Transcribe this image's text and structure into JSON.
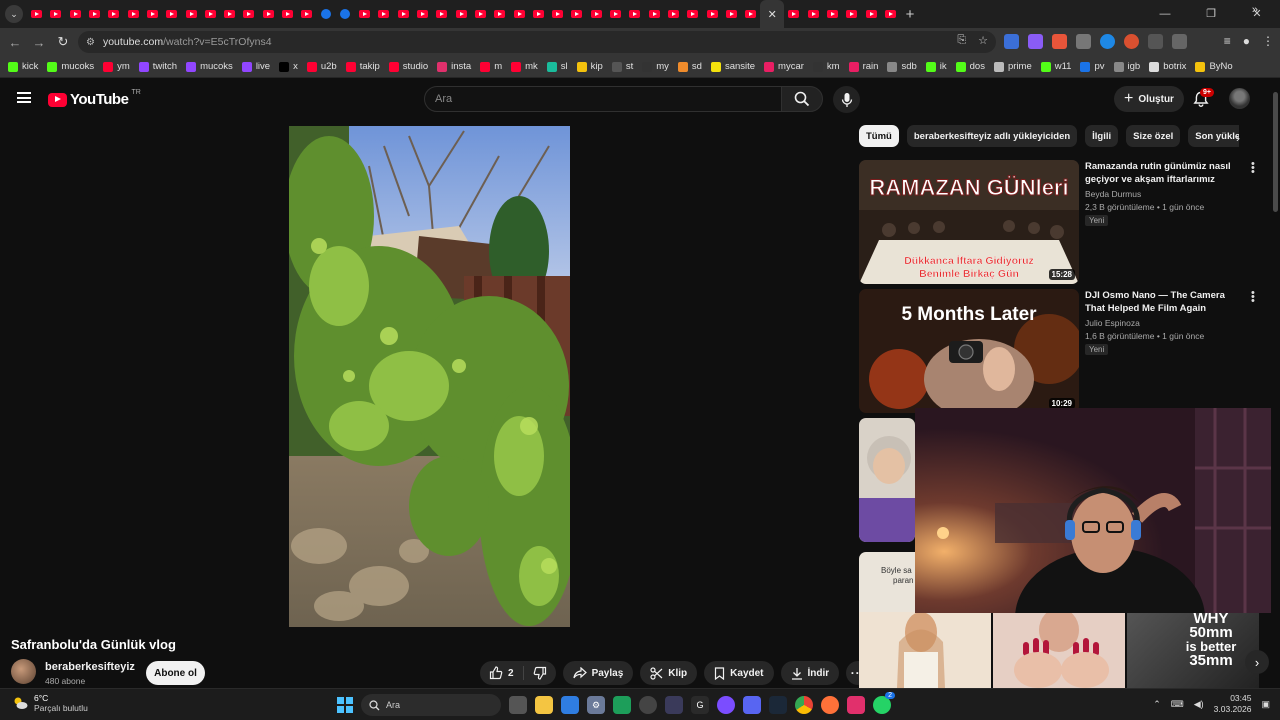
{
  "browser": {
    "url_host": "youtube.com",
    "url_path": "/watch?v=E5cTrOfyns4",
    "tab_count": 44,
    "new_tab_label": "+",
    "bookmarks": [
      {
        "label": "kick",
        "color": "#53fc18"
      },
      {
        "label": "mucoks",
        "color": "#53fc18"
      },
      {
        "label": "ym",
        "color": "#ff0033"
      },
      {
        "label": "twitch",
        "color": "#9146ff"
      },
      {
        "label": "mucoks",
        "color": "#9146ff"
      },
      {
        "label": "live",
        "color": "#9146ff"
      },
      {
        "label": "x",
        "color": "#000000"
      },
      {
        "label": "u2b",
        "color": "#ff0033"
      },
      {
        "label": "takip",
        "color": "#ff0033"
      },
      {
        "label": "studio",
        "color": "#ff0033"
      },
      {
        "label": "insta",
        "color": "#e1306c"
      },
      {
        "label": "m",
        "color": "#ff0033"
      },
      {
        "label": "mk",
        "color": "#ff0033"
      },
      {
        "label": "sl",
        "color": "#1abc9c"
      },
      {
        "label": "kip",
        "color": "#f4c20d"
      },
      {
        "label": "st",
        "color": "#555555"
      },
      {
        "label": "my",
        "color": "#333333"
      },
      {
        "label": "sd",
        "color": "#f08c2c"
      },
      {
        "label": "sansite",
        "color": "#f4e20d"
      },
      {
        "label": "mycar",
        "color": "#e91e63"
      },
      {
        "label": "km",
        "color": "#333333"
      },
      {
        "label": "rain",
        "color": "#e91e63"
      },
      {
        "label": "sdb",
        "color": "#888888"
      },
      {
        "label": "ik",
        "color": "#53fc18"
      },
      {
        "label": "dos",
        "color": "#53fc18"
      },
      {
        "label": "prime",
        "color": "#bbbbbb"
      },
      {
        "label": "w11",
        "color": "#53fc18"
      },
      {
        "label": "pv",
        "color": "#1a73e8"
      },
      {
        "label": "igb",
        "color": "#888888"
      },
      {
        "label": "botrix",
        "color": "#dddddd"
      },
      {
        "label": "ByNo",
        "color": "#f4c20d"
      }
    ]
  },
  "header": {
    "logo_text": "YouTube",
    "country_code": "TR",
    "search_placeholder": "Ara",
    "create_label": "Oluştur",
    "notifications_badge": "9+"
  },
  "video": {
    "title": "Safranbolu'da Günlük vlog",
    "channel": "beraberkesifteyiz",
    "subscribers": "480 abone",
    "subscribe_label": "Abone ol",
    "likes": "2",
    "share_label": "Paylaş",
    "clip_label": "Klip",
    "save_label": "Kaydet",
    "download_label": "İndir"
  },
  "chips": [
    "Tümü",
    "beraberkesifteyiz adlı yükleyiciden",
    "İlgili",
    "Size özel",
    "Son yüklenenler"
  ],
  "recommendations": [
    {
      "title": "Ramazanda rutin günümüz nasıl geçiyor ve akşam iftarlarımız sizlerle...",
      "channel": "Beyda Durmus",
      "meta": "2,3 B görüntüleme • 1 gün önce",
      "badge": "Yeni",
      "duration": "15:28",
      "thumb_text_top": "RAMAZAN GÜNleri",
      "thumb_text_bottom_1": "Dükkanca İftara Gidiyoruz",
      "thumb_text_bottom_2": "Benimle Birkaç Gün"
    },
    {
      "title": "DJI Osmo Nano — The Camera That Helped Me Film Again",
      "channel": "Julio Espinoza",
      "meta": "1,6 B görüntüleme • 1 gün önce",
      "badge": "Yeni",
      "duration": "10:29",
      "thumb_text_top": "5 Months Later"
    }
  ],
  "shorts": {
    "partial_caption_1": "Böyle sa",
    "partial_caption_2": "paran",
    "third_caption_1": "WHY",
    "third_caption_2": "50mm",
    "third_caption_3": "is better",
    "third_caption_4": "35mm"
  },
  "taskbar": {
    "temperature": "6°C",
    "weather": "Parçalı bulutlu",
    "search_label": "Ara",
    "time": "03:45",
    "date": "3.03.2026",
    "whatsapp_badge": "2"
  }
}
